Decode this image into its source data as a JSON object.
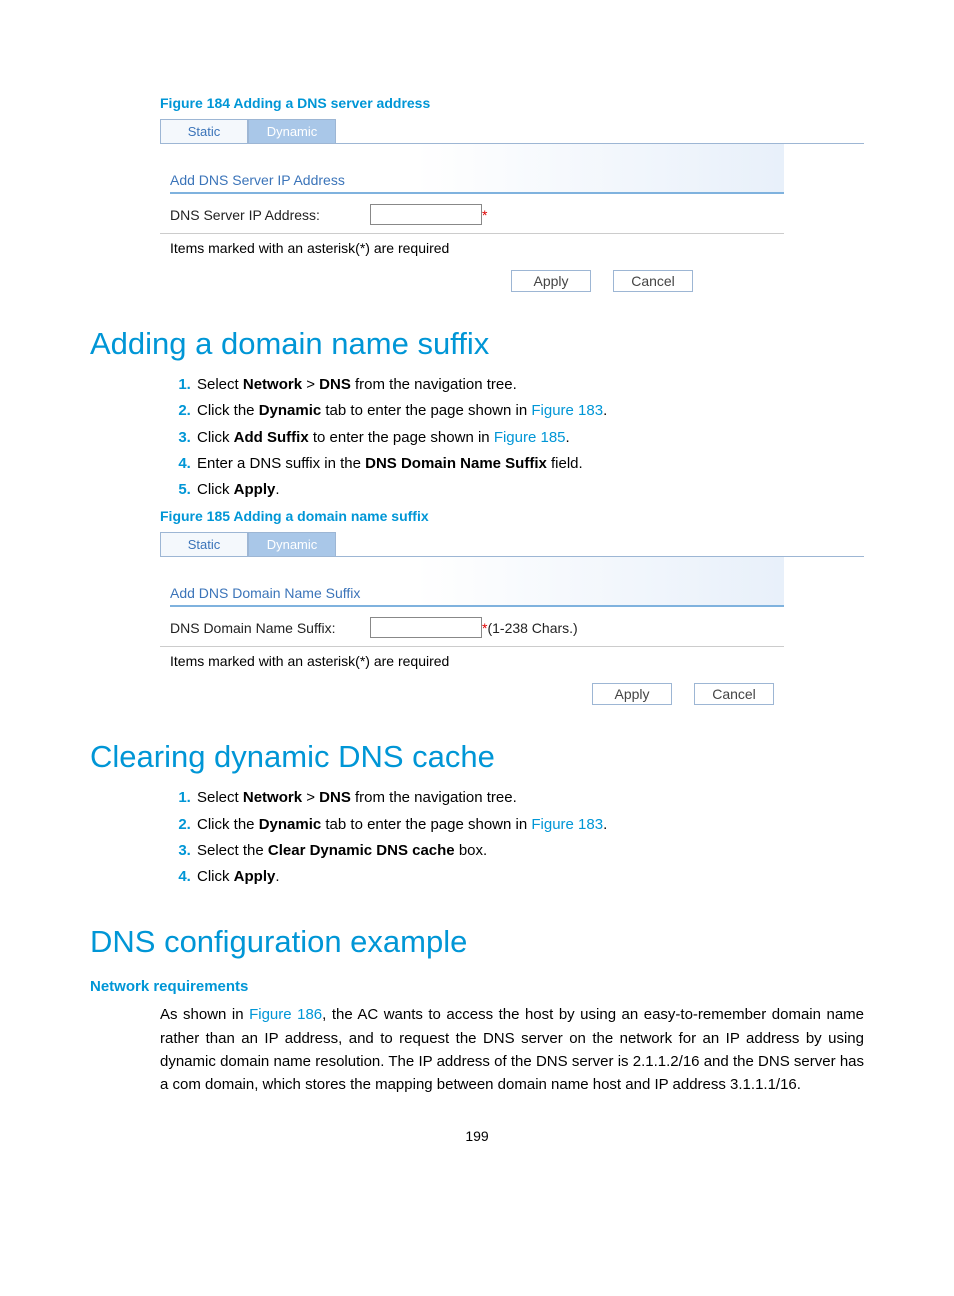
{
  "figure184": {
    "caption": "Figure 184 Adding a DNS server address",
    "tabs": {
      "static": "Static",
      "dynamic": "Dynamic"
    },
    "section_title": "Add DNS Server IP Address",
    "label": "DNS Server IP Address:",
    "asterisk": "*",
    "info": "Items marked with an asterisk(*) are required",
    "apply": "Apply",
    "cancel": "Cancel"
  },
  "section1": {
    "heading": "Adding a domain name suffix",
    "step1_pre": "Select ",
    "step1_b1": "Network",
    "step1_mid": " > ",
    "step1_b2": "DNS",
    "step1_post": " from the navigation tree.",
    "step2_pre": "Click the ",
    "step2_b": "Dynamic",
    "step2_mid": " tab to enter the page shown in ",
    "step2_link": "Figure 183",
    "step2_post": ".",
    "step3_pre": "Click ",
    "step3_b": "Add Suffix",
    "step3_mid": " to enter the page shown in ",
    "step3_link": "Figure 185",
    "step3_post": ".",
    "step4_pre": "Enter a DNS suffix in the ",
    "step4_b": "DNS Domain Name Suffix",
    "step4_post": " field.",
    "step5_pre": "Click ",
    "step5_b": "Apply",
    "step5_post": "."
  },
  "figure185": {
    "caption": "Figure 185 Adding a domain name suffix",
    "tabs": {
      "static": "Static",
      "dynamic": "Dynamic"
    },
    "section_title": "Add DNS Domain Name Suffix",
    "label": "DNS Domain Name Suffix:",
    "asterisk": "*",
    "hint": "(1-238 Chars.)",
    "info": "Items marked with an asterisk(*) are required",
    "apply": "Apply",
    "cancel": "Cancel"
  },
  "section2": {
    "heading": "Clearing dynamic DNS cache",
    "step1_pre": "Select ",
    "step1_b1": "Network",
    "step1_mid": " > ",
    "step1_b2": "DNS",
    "step1_post": " from the navigation tree.",
    "step2_pre": "Click the ",
    "step2_b": "Dynamic",
    "step2_mid": " tab to enter the page shown in ",
    "step2_link": "Figure 183",
    "step2_post": ".",
    "step3_pre": "Select the ",
    "step3_b": "Clear Dynamic DNS cache",
    "step3_post": " box.",
    "step4_pre": "Click ",
    "step4_b": "Apply",
    "step4_post": "."
  },
  "section3": {
    "heading": "DNS configuration example",
    "subheading": "Network requirements",
    "body_pre": "As shown in ",
    "body_link": "Figure 186",
    "body_post": ", the AC wants to access the host by using an easy-to-remember domain name rather than an IP address, and to request the DNS server on the network for an IP address by using dynamic domain name resolution. The IP address of the DNS server is 2.1.1.2/16 and the DNS server has a com domain, which stores the mapping between domain name host and IP address 3.1.1.1/16."
  },
  "page_number": "199"
}
